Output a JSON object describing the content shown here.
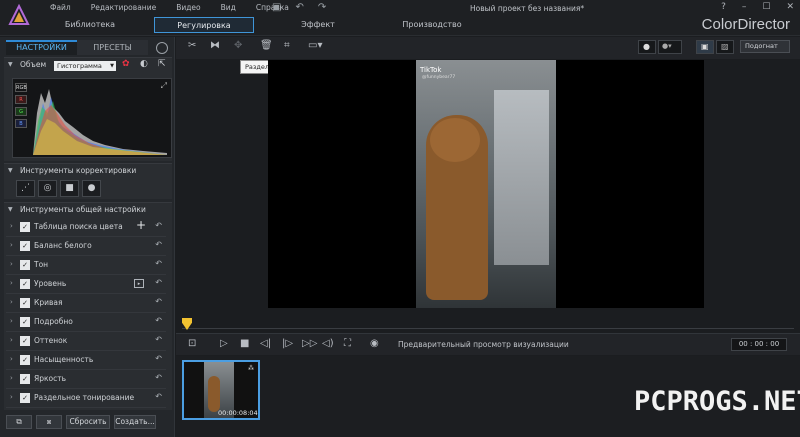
{
  "menu": [
    "Файл",
    "Редактирование",
    "Видео",
    "Вид",
    "Справка"
  ],
  "document_title": "Новый проект без названия*",
  "brand": "ColorDirector",
  "tabs": [
    {
      "label": "Библиотека",
      "active": false
    },
    {
      "label": "Регулировка",
      "active": true
    },
    {
      "label": "Эффект",
      "active": false
    },
    {
      "label": "Производство",
      "active": false
    }
  ],
  "panel_tabs": {
    "settings": "НАСТРОЙКИ",
    "presets": "ПРЕСЕТЫ"
  },
  "volume_section": {
    "title": "Объем",
    "mode": "Гистограмма"
  },
  "channels": [
    "RGB",
    "R",
    "G",
    "B"
  ],
  "correction_section": {
    "title": "Инструменты корректировки"
  },
  "general_section": {
    "title": "Инструменты общей настройки"
  },
  "adjustments": [
    "Таблица поиска цвета",
    "Баланс белого",
    "Тон",
    "Уровень",
    "Кривая",
    "Подробно",
    "Оттенок",
    "Насыщенность",
    "Яркость",
    "Раздельное тонирование"
  ],
  "bottom_buttons": {
    "reset": "Сбросить",
    "create": "Создать..."
  },
  "tooltip": "Разделить выбранный клип",
  "fit": "Подогнат",
  "video": {
    "watermark_app": "TikTok",
    "watermark_user": "@funnybear77"
  },
  "preview_label": "Предварительный просмотр визуализации",
  "timecode": "00 : 00 : 00",
  "clip_time": "00:00:08:04",
  "site_watermark": "PCPROGS.NET",
  "colors": {
    "accent": "#3f95d8",
    "playhead": "#f2c230"
  }
}
